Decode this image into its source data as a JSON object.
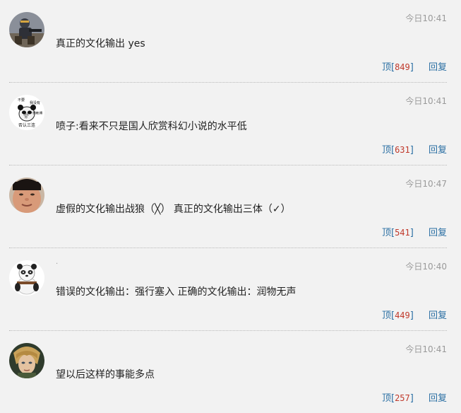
{
  "comments": [
    {
      "avatar_icon": "armored-soldier-avatar-icon",
      "dot": "",
      "time": "今日10:41",
      "text": "真正的文化输出 yes",
      "up_label": "顶",
      "up_count": "849",
      "reply_label": "回复"
    },
    {
      "avatar_icon": "panda-meme-avatar-icon",
      "dot": "",
      "time": "今日10:41",
      "text": "喷子:看来不只是国人欣赏科幻小说的水平低",
      "up_label": "顶",
      "up_count": "631",
      "reply_label": "回复"
    },
    {
      "avatar_icon": "round-face-avatar-icon",
      "dot": "",
      "time": "今日10:47",
      "text": "虚假的文化输出战狼（╳） 真正的文化输出三体（✓）",
      "up_label": "顶",
      "up_count": "541",
      "reply_label": "回复"
    },
    {
      "avatar_icon": "kungfu-panda-avatar-icon",
      "dot": "·",
      "time": "今日10:40",
      "text": "错误的文化输出：强行塞入 正确的文化输出：润物无声",
      "up_label": "顶",
      "up_count": "449",
      "reply_label": "回复"
    },
    {
      "avatar_icon": "elf-character-avatar-icon",
      "dot": "",
      "time": "今日10:41",
      "text": "望以后这样的事能多点",
      "up_label": "顶",
      "up_count": "257",
      "reply_label": "回复"
    }
  ],
  "avatar_panda_text": [
    "不要",
    "我没有",
    "想说",
    "你",
    "想被",
    "吐糟",
    "否认三连"
  ]
}
